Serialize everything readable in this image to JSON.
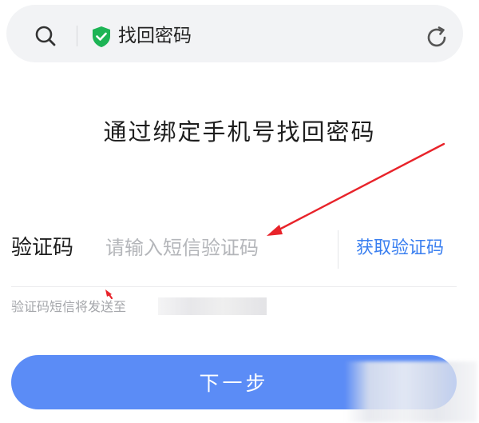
{
  "browser": {
    "title": "找回密码",
    "icons": {
      "search": "search-icon",
      "security": "shield-check-icon",
      "refresh": "refresh-icon"
    },
    "shield_color": "#1db455"
  },
  "main": {
    "heading": "通过绑定手机号找回密码",
    "code_label": "验证码",
    "code_placeholder": "请输入短信验证码",
    "code_value": "",
    "get_code_label": "获取验证码",
    "hint": "验证码短信将发送至",
    "next_label": "下一步"
  },
  "colors": {
    "accent": "#3a7ff0",
    "button": "#5b8cf6",
    "annotation": "#e8232a"
  }
}
